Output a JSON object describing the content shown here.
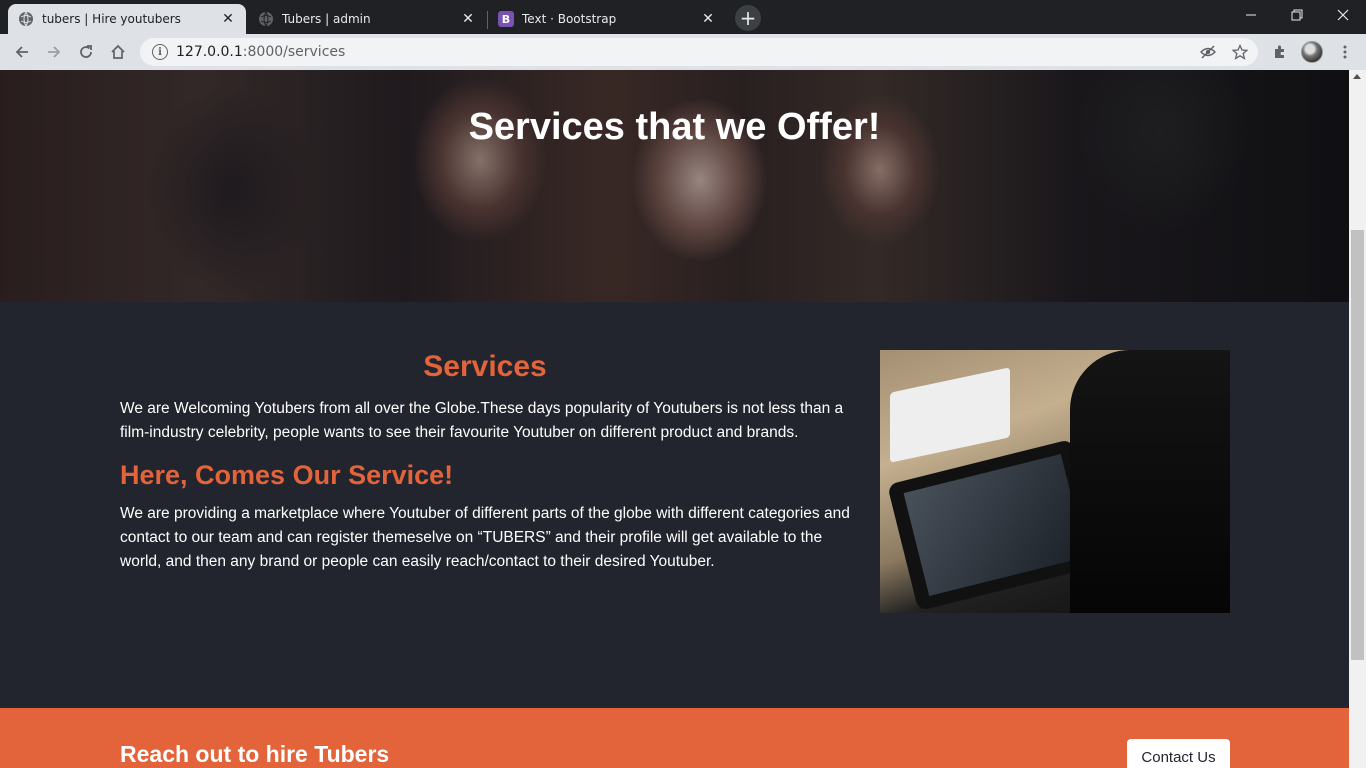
{
  "browser": {
    "tabs": [
      {
        "title": "tubers | Hire youtubers",
        "active": true,
        "favicon": "globe-icon"
      },
      {
        "title": "Tubers | admin",
        "active": false,
        "favicon": "globe-icon"
      },
      {
        "title": "Text · Bootstrap",
        "active": false,
        "favicon": "bootstrap-icon",
        "favicon_text": "B"
      }
    ],
    "url_host": "127.0.0.1",
    "url_path": ":8000/services"
  },
  "hero": {
    "title": "Services that we Offer!"
  },
  "services": {
    "heading": "Services",
    "intro": "We are Welcoming Yotubers from all over the Globe.These days popularity of Youtubers is not less than a film-industry celebrity, people wants to see their favourite Youtuber on different product and brands.",
    "subheading": "Here, Comes Our Service!",
    "body": "We are providing a marketplace where Youtuber of different parts of the globe with different categories and contact to our team and can register themeselve on “TUBERS” and their profile will get available to the world, and then any brand or people can easily reach/contact to their desired Youtuber."
  },
  "cta": {
    "text": "Reach out to hire Tubers",
    "button": "Contact Us"
  },
  "colors": {
    "accent": "#e3633a",
    "dark_bg": "#22252d"
  }
}
